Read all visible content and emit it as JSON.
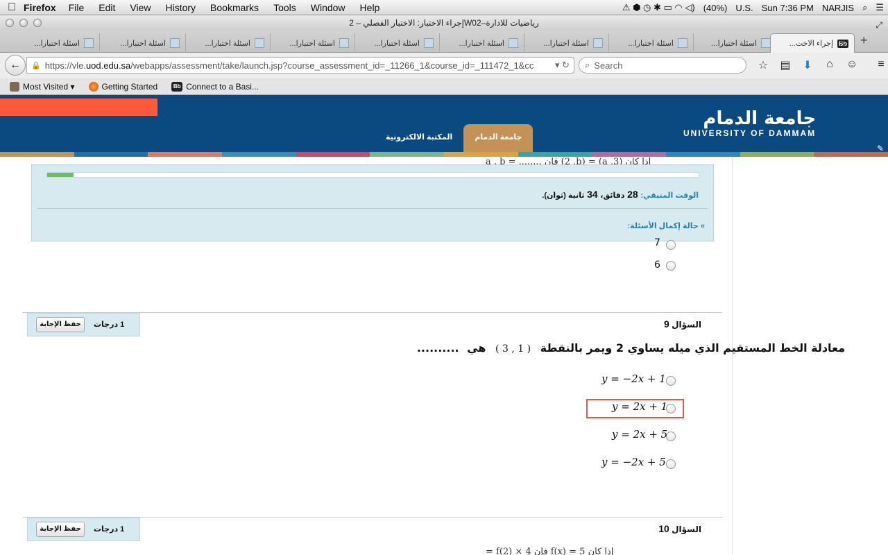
{
  "menubar": {
    "apple": "",
    "app": "Firefox",
    "items": [
      "File",
      "Edit",
      "View",
      "History",
      "Bookmarks",
      "Tools",
      "Window",
      "Help"
    ],
    "battery": "(40%)",
    "input": "U.S.",
    "clock": "Sun 7:36 PM",
    "user": "NARJIS"
  },
  "window": {
    "title": "إجراء الاختبار: الاختبار الفصلي – 2W02–رياضيات للادارة"
  },
  "tabs": [
    {
      "label": "اسئلة اختبارا..."
    },
    {
      "label": "اسئلة اختبارا..."
    },
    {
      "label": "اسئلة اختبارا..."
    },
    {
      "label": "اسئلة اختبارا..."
    },
    {
      "label": "اسئلة اختبارا..."
    },
    {
      "label": "اسئلة اختبارا..."
    },
    {
      "label": "اسئلة اختبارا..."
    },
    {
      "label": "اسئلة اختبارا..."
    },
    {
      "label": "اسئلة اختبارا..."
    }
  ],
  "active_tab": {
    "icon": "Bb",
    "label": "إجراء الاخت..."
  },
  "nav": {
    "url_prefix": "https://vle.",
    "url_host": "uod.edu.sa",
    "url_rest": "/webapps/assessment/take/launch.jsp?course_assessment_id=_11266_1&course_id=_111472_1&cc",
    "search_placeholder": "Search"
  },
  "bookmarks": [
    {
      "label": "Most Visited ▾",
      "icon": "star"
    },
    {
      "label": "Getting Started",
      "icon": "firefox"
    },
    {
      "label": "Connect to a Basi...",
      "icon": "bb"
    }
  ],
  "header": {
    "logo_ar": "جامعة الدمام",
    "logo_en": "UNIVERSITY OF DAMMAM",
    "tabs": [
      "جامعة الدمام",
      "المكتبة الالكترونية"
    ],
    "colorbar": [
      "#c49157",
      "#1f6fa8",
      "#e07a5f",
      "#3a8fb7",
      "#c94a6b",
      "#7fb38a",
      "#d9a441",
      "#3aa3a3",
      "#b56a9a",
      "#2e86c1",
      "#8fae5a",
      "#c46a4a"
    ]
  },
  "timer": {
    "progress": 0.04,
    "label": "الوقت المتبقي:",
    "minutes": "28",
    "minutes_unit": "دقائق،",
    "seconds": "34",
    "seconds_unit": "ثانية (ثوان).",
    "status": "حالة إكمال الأسئلة:"
  },
  "prev_question": {
    "partial": "إذا كان (a ,3) = (2 ,b) فإن ........ = a . b",
    "options": [
      "7",
      "6"
    ]
  },
  "questions": [
    {
      "label": "السؤال",
      "number": "9",
      "points": "1 درجات",
      "save": "حفظ الإجابة",
      "text": "معادلة الخط المستقيم الذي ميله يساوي 2 ويمر بالنقطة",
      "point": "( 1 , 3 )",
      "suffix": "هي",
      "dots": "..........",
      "options": [
        "y = −2x + 1",
        "y = 2x + 1",
        "y = 2x + 5",
        "y = −2x + 5"
      ]
    },
    {
      "label": "السؤال",
      "number": "10",
      "points": "1 درجات",
      "save": "حفظ الإجابة",
      "partial": "إذا كان f(x) = 5 فإن 4 × f(2) ="
    }
  ]
}
